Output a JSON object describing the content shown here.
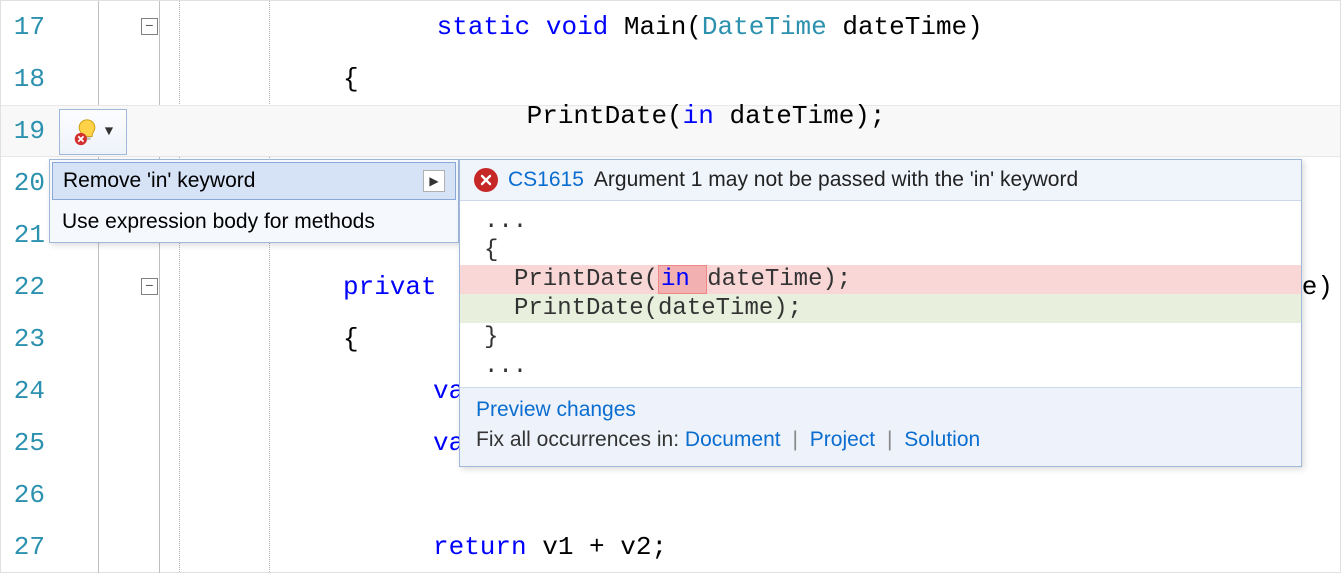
{
  "lines": {
    "17": {
      "num": "17"
    },
    "18": {
      "num": "18"
    },
    "19": {
      "num": "19"
    },
    "20": {
      "num": "20"
    },
    "21": {
      "num": "21"
    },
    "22": {
      "num": "22"
    },
    "23": {
      "num": "23"
    },
    "24": {
      "num": "24"
    },
    "25": {
      "num": "25"
    },
    "26": {
      "num": "26"
    },
    "27": {
      "num": "27"
    }
  },
  "code": {
    "l17_kw1": "static",
    "l17_kw2": "void",
    "l17_name": " Main(",
    "l17_type": "DateTime",
    "l17_rest": " dateTime)",
    "l18": "{",
    "l19_a": "PrintDate(",
    "l19_kw": "in",
    "l19_b": " dateTime);",
    "l22_kw": "privat",
    "l22_tail": "e)",
    "l23": "{",
    "l24": "va",
    "l25": "va",
    "l27_kw": "return",
    "l27_rest": " v1 + v2;"
  },
  "bulb": {
    "name": "quick-actions"
  },
  "actions": {
    "item0": "Remove 'in' keyword",
    "item1": "Use expression body for methods"
  },
  "error": {
    "code": "CS1615",
    "message": " Argument 1 may not be passed with the 'in' keyword"
  },
  "diff": {
    "dots": "...",
    "brace_open": "{",
    "brace_close": "}",
    "del_a": "PrintDate(",
    "del_chg": "in ",
    "del_b": "dateTime);",
    "add": "PrintDate(dateTime);"
  },
  "footer": {
    "preview": "Preview changes",
    "prefix": "Fix all occurrences in: ",
    "doc": "Document",
    "proj": "Project",
    "sol": "Solution",
    "sep": "|"
  }
}
